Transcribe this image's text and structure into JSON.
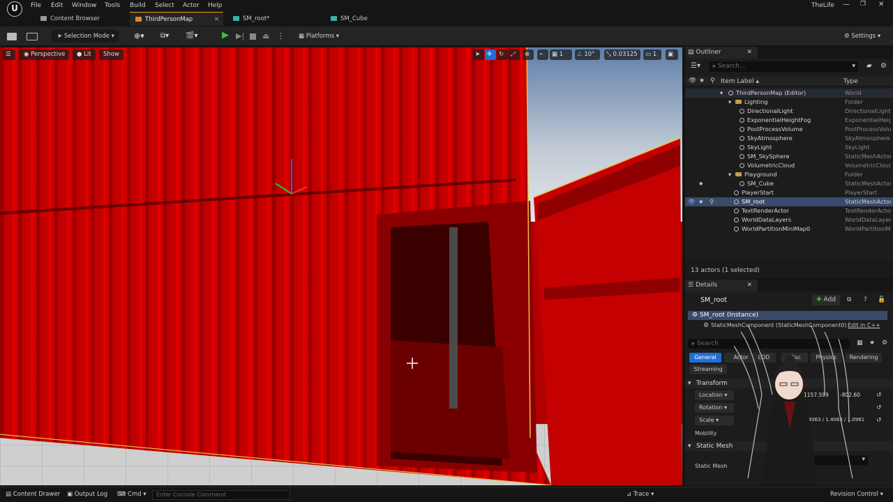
{
  "menubar": {
    "items": [
      "File",
      "Edit",
      "Window",
      "Tools",
      "Build",
      "Select",
      "Actor",
      "Help"
    ],
    "project_name": "TheLife"
  },
  "tabs": [
    {
      "label": "Content Browser"
    },
    {
      "label": "ThirdPersonMap"
    },
    {
      "label": "SM_root*"
    },
    {
      "label": "SM_Cube"
    }
  ],
  "toolbar": {
    "selection_mode": "Selection Mode",
    "platforms": "Platforms",
    "settings": "Settings"
  },
  "viewport": {
    "perspective": "Perspective",
    "lit": "Lit",
    "show": "Show",
    "grid_size": "1",
    "angle": "10°",
    "scale": "0.03125",
    "camera": "1"
  },
  "outliner": {
    "title": "Outliner",
    "search_placeholder": "Search...",
    "col_label": "Item Label ▴",
    "col_type": "Type",
    "rows": [
      {
        "label": "ThirdPersonMap (Editor)",
        "type": "World"
      },
      {
        "label": "Lighting",
        "type": "Folder"
      },
      {
        "label": "DirectionalLight",
        "type": "DirectionalLight"
      },
      {
        "label": "ExponentialHeightFog",
        "type": "ExponentialHeightFog"
      },
      {
        "label": "PostProcessVolume",
        "type": "PostProcessVolume"
      },
      {
        "label": "SkyAtmosphere",
        "type": "SkyAtmosphere"
      },
      {
        "label": "SkyLight",
        "type": "SkyLight"
      },
      {
        "label": "SM_SkySphere",
        "type": "StaticMeshActor"
      },
      {
        "label": "VolumetricCloud",
        "type": "VolumetricCloud"
      },
      {
        "label": "Playground",
        "type": "Folder"
      },
      {
        "label": "SM_Cube",
        "type": "StaticMeshActor"
      },
      {
        "label": "PlayerStart",
        "type": "PlayerStart"
      },
      {
        "label": "SM_root",
        "type": "StaticMeshActor"
      },
      {
        "label": "TextRenderActor",
        "type": "TextRenderActor"
      },
      {
        "label": "WorldDataLayers",
        "type": "WorldDataLayers"
      },
      {
        "label": "WorldPartitionMiniMap0",
        "type": "WorldPartitionMiniMap"
      }
    ],
    "status": "13 actors (1 selected)"
  },
  "details": {
    "title": "Details",
    "actor_name": "SM_root",
    "add_label": "Add",
    "instance_label": "SM_root (Instance)",
    "component_label": "StaticMeshComponent (StaticMeshComponent0)",
    "edit_cpp": "Edit in C++",
    "search_placeholder": "Search",
    "filter_tabs": [
      "General",
      "Actor",
      "LOD",
      "Misc",
      "Physics",
      "Rendering"
    ],
    "streaming_label": "Streaming",
    "transform_header": "Transform",
    "location_label": "Location",
    "rotation_label": "Rotation",
    "scale_label": "Scale",
    "mobility_label": "Mobility",
    "location_x": "1157.599",
    "location_y": "-802.60",
    "scale_values": "1.4063 / 1.4063 / 1.0961",
    "static_mesh_header": "Static Mesh",
    "static_mesh_label": "Static Mesh"
  },
  "bottombar": {
    "content_drawer": "Content Drawer",
    "output_log": "Output Log",
    "cmd": "Cmd",
    "console_placeholder": "Enter Console Command",
    "trace": "Trace",
    "revision_control": "Revision Control"
  },
  "colors": {
    "accent": "#f0a000",
    "selection": "#3a4a6a",
    "container_red": "#c00000",
    "play_green": "#3fbf3f",
    "general_tab": "#1f6fd6"
  }
}
